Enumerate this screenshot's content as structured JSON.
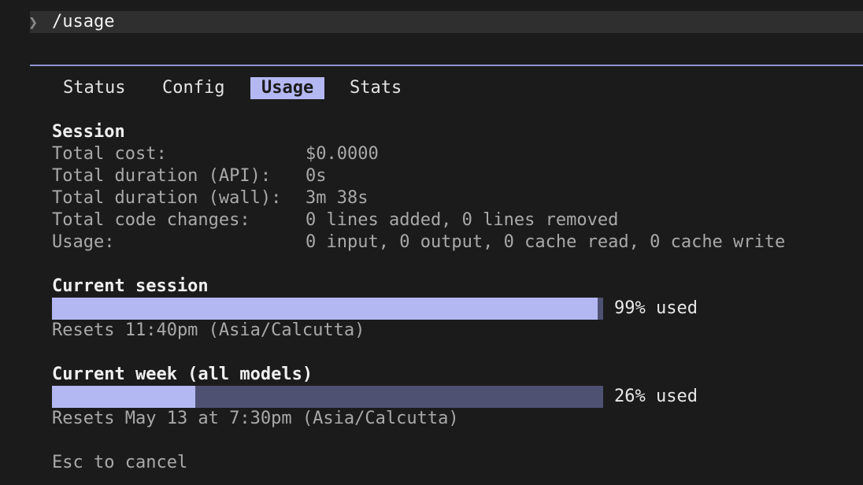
{
  "command": {
    "prompt_symbol": "❯",
    "text": "/usage"
  },
  "tabs": [
    {
      "label": "Status",
      "active": false
    },
    {
      "label": "Config",
      "active": false
    },
    {
      "label": "Usage",
      "active": true
    },
    {
      "label": "Stats",
      "active": false
    }
  ],
  "session": {
    "heading": "Session",
    "rows": [
      {
        "label": "Total cost:",
        "value": "$0.0000"
      },
      {
        "label": "Total duration (API):",
        "value": "0s"
      },
      {
        "label": "Total duration (wall):",
        "value": "3m 38s"
      },
      {
        "label": "Total code changes:",
        "value": "0 lines added, 0 lines removed"
      },
      {
        "label": "Usage:",
        "value": "0 input, 0 output, 0 cache read, 0 cache write"
      }
    ]
  },
  "current_session": {
    "heading": "Current session",
    "percent": 99,
    "used_label": "99% used",
    "reset_text": "Resets 11:40pm (Asia/Calcutta)"
  },
  "current_week": {
    "heading": "Current week (all models)",
    "percent": 26,
    "used_label": "26% used",
    "reset_text": "Resets May 13 at 7:30pm (Asia/Calcutta)"
  },
  "footer": {
    "hint": "Esc to cancel"
  },
  "colors": {
    "accent": "#b4b8f2",
    "track": "#4f5173",
    "background": "#1b1b1b"
  }
}
